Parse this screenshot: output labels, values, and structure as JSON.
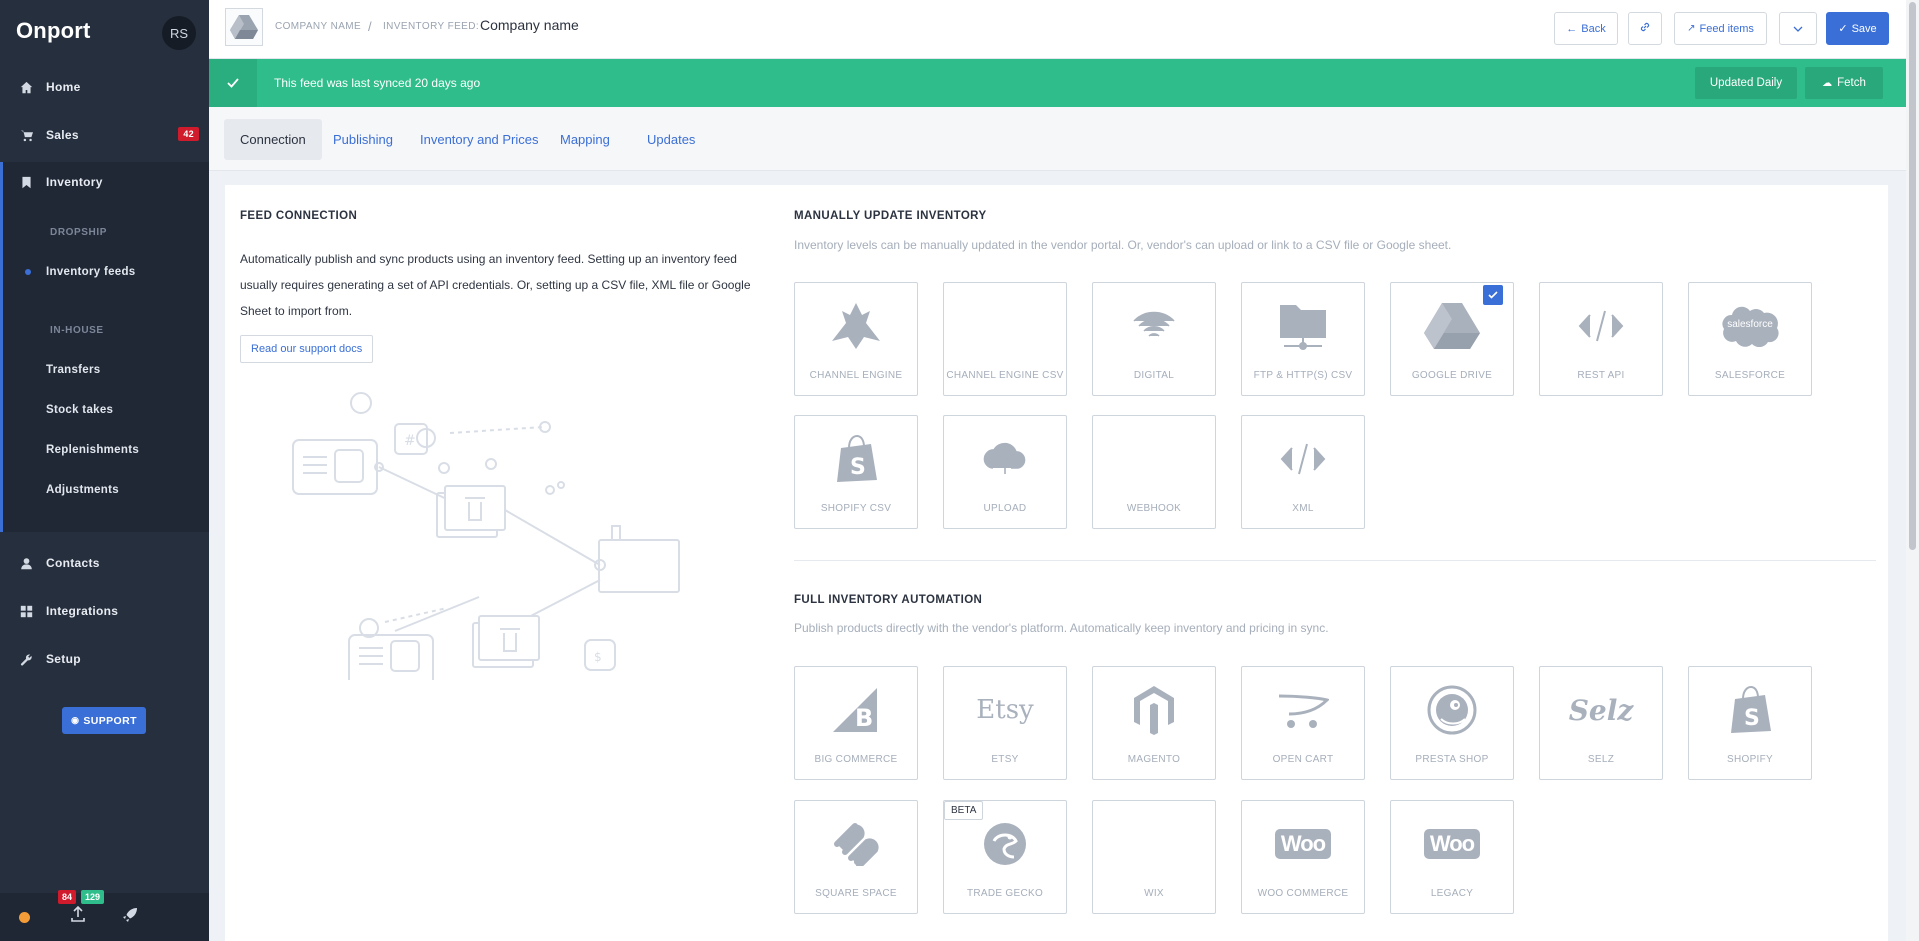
{
  "sidebar": {
    "brand": "Onport",
    "avatar": "RS",
    "home": "Home",
    "sales": "Sales",
    "sales_badge": "42",
    "inventory": "Inventory",
    "dropship": "DROPSHIP",
    "inventory_feeds": "Inventory feeds",
    "in_house": "IN-HOUSE",
    "transfers": "Transfers",
    "stock_takes": "Stock takes",
    "replenishments": "Replenishments",
    "adjustments": "Adjustments",
    "contacts": "Contacts",
    "integrations": "Integrations",
    "setup": "Setup",
    "support": "SUPPORT",
    "count_red": "84",
    "count_green": "129"
  },
  "header": {
    "crumb_company": "COMPANY NAME",
    "crumb_sep": "/",
    "crumb_feed": "INVENTORY FEED:",
    "title": "Company name",
    "back": "Back",
    "feed_items": "Feed items",
    "save": "Save"
  },
  "banner": {
    "message": "This feed was last synced 20 days ago",
    "updated": "Updated Daily",
    "fetch": "Fetch"
  },
  "tabs": [
    "Connection",
    "Publishing",
    "Inventory and Prices",
    "Mapping",
    "Updates"
  ],
  "feed_connection": {
    "heading": "FEED CONNECTION",
    "line1": "Automatically publish and sync products using an inventory feed. Setting up an inventory feed",
    "line2": "usually requires generating a set of API credentials. Or, setting up a CSV file, XML file or Google",
    "line3": "Sheet to import from.",
    "docs": "Read our support docs"
  },
  "manual": {
    "heading": "MANUALLY UPDATE INVENTORY",
    "desc": "Inventory levels can be manually updated in the vendor portal. Or, vendor's can upload or link to a CSV file or Google sheet.",
    "tiles": [
      "CHANNEL ENGINE",
      "CHANNEL ENGINE CSV",
      "DIGITAL",
      "FTP & HTTP(S) CSV",
      "GOOGLE DRIVE",
      "REST API",
      "SALESFORCE",
      "SHOPIFY CSV",
      "UPLOAD",
      "WEBHOOK",
      "XML"
    ],
    "salesforce_logo": "salesforce"
  },
  "full": {
    "heading": "FULL INVENTORY AUTOMATION",
    "desc": "Publish products directly with the vendor's platform. Automatically keep inventory and pricing in sync.",
    "tiles": [
      "BIG COMMERCE",
      "ETSY",
      "MAGENTO",
      "OPEN CART",
      "PRESTA SHOP",
      "SELZ",
      "SHOPIFY",
      "SQUARE SPACE",
      "TRADE GECKO",
      "WIX",
      "WOO COMMERCE",
      "LEGACY"
    ],
    "beta": "BETA",
    "etsy_logo": "Etsy",
    "selz_logo": "Selz",
    "woo_logo": "Woo"
  },
  "colors": {
    "accent": "#3a6fd8",
    "sidebar": "#262f3d",
    "banner": "#2fbd8b",
    "badge_red": "#d01b2c"
  }
}
